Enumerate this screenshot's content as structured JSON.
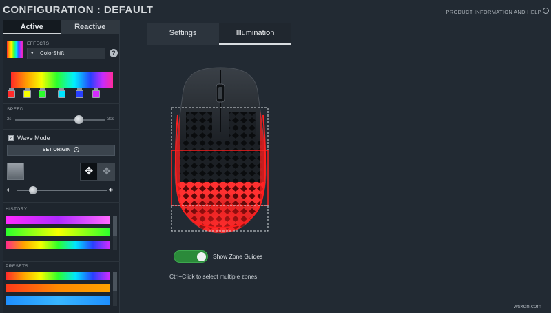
{
  "header": {
    "title": "CONFIGURATION : DEFAULT",
    "product_info": "PRODUCT INFORMATION AND HELP"
  },
  "left_tabs": [
    {
      "label": "Active",
      "selected": true
    },
    {
      "label": "Reactive",
      "selected": false
    }
  ],
  "effects": {
    "label": "EFFECTS",
    "selected": "ColorShift",
    "help": "?"
  },
  "gradient": {
    "stop_colors": [
      "#ff2a2a",
      "#f6ff00",
      "#2cff2c",
      "#00e5ff",
      "#2840ff",
      "#d52bff"
    ]
  },
  "speed": {
    "label": "SPEED",
    "min_label": "2s",
    "max_label": "30s",
    "value_fraction": 0.71
  },
  "wave_mode": {
    "label": "Wave Mode",
    "checked": true,
    "set_origin_label": "SET ORIGIN"
  },
  "volume": {
    "value_fraction": 0.18
  },
  "history": {
    "label": "HISTORY",
    "swatches": [
      [
        "#ff2bff",
        "#b02bff",
        "#ff6bff"
      ],
      [
        "#2cff2c",
        "#f6ff00",
        "#2cff2c"
      ],
      [
        "#ff2a8a",
        "#ffa200",
        "#f6ff00",
        "#2cff2c",
        "#00e5ff",
        "#2840ff",
        "#d52bff"
      ]
    ]
  },
  "presets": {
    "label": "PRESETS",
    "swatches": [
      [
        "#ff2a2a",
        "#ffa200",
        "#f6ff00",
        "#2cff2c",
        "#00e5ff",
        "#2840ff",
        "#d52bff"
      ],
      [
        "#ff3a1a",
        "#ff8a00",
        "#ffa200"
      ],
      [
        "#1e8fff",
        "#38b6ff",
        "#1e8fff"
      ]
    ]
  },
  "main_tabs": [
    {
      "label": "Settings",
      "selected": false
    },
    {
      "label": "Illumination",
      "selected": true
    }
  ],
  "zone_guides": {
    "label": "Show Zone Guides",
    "enabled": true
  },
  "hint": "Ctrl+Click to select multiple zones.",
  "watermark": "wsxdn.com",
  "colors": {
    "accent_red": "#ff2020",
    "toggle_green": "#2b8a3a"
  }
}
